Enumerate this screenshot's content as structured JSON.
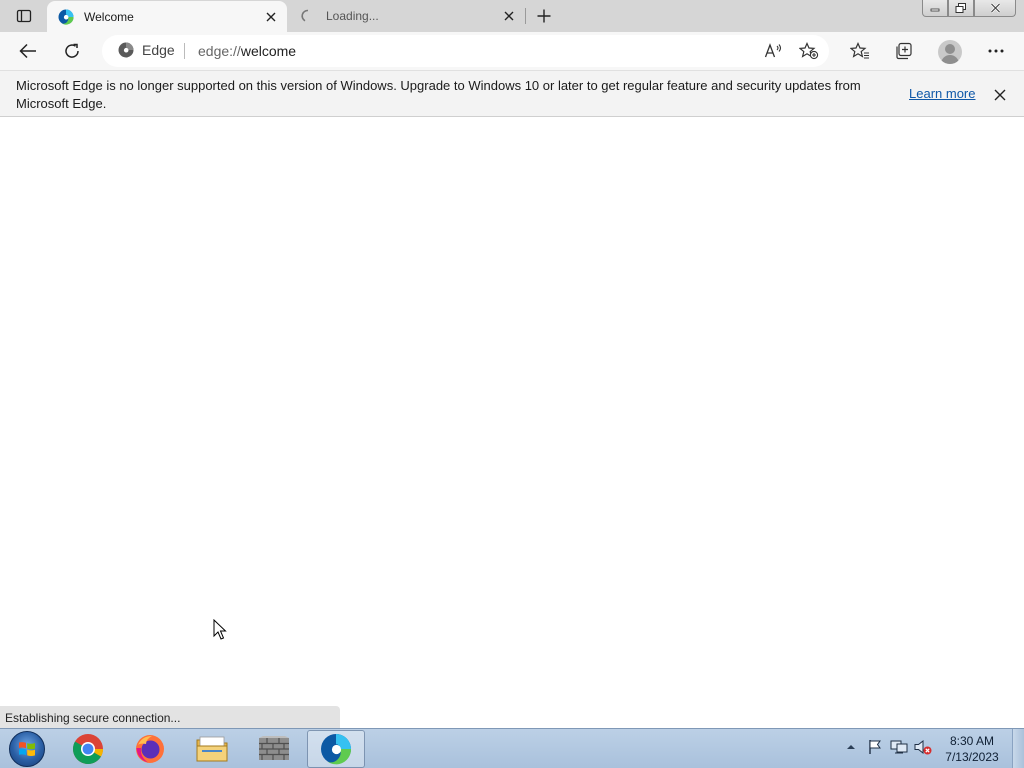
{
  "browser": {
    "tabs": [
      {
        "title": "Welcome",
        "active": true
      },
      {
        "title": "Loading...",
        "active": false
      }
    ],
    "address": {
      "site_label": "Edge",
      "url_scheme": "edge://",
      "url_path": "welcome"
    },
    "infobar": {
      "message": "Microsoft Edge is no longer supported on this version of Windows. Upgrade to Windows 10 or later to get regular feature and security updates from Microsoft Edge.",
      "link_label": "Learn more"
    },
    "status_text": "Establishing secure connection..."
  },
  "taskbar": {
    "apps": [
      {
        "name": "chrome-icon",
        "active": false
      },
      {
        "name": "firefox-icon",
        "active": false
      },
      {
        "name": "file-explorer-icon",
        "active": false
      },
      {
        "name": "firewall-icon",
        "active": false
      },
      {
        "name": "edge-icon",
        "active": true
      }
    ],
    "clock": {
      "time": "8:30 AM",
      "date": "7/13/2023"
    }
  },
  "colors": {
    "tabstrip_bg": "#d6d6d6",
    "toolbar_bg": "#f7f7f7",
    "link": "#0f58a8",
    "taskbar": "#bcd0e6"
  }
}
